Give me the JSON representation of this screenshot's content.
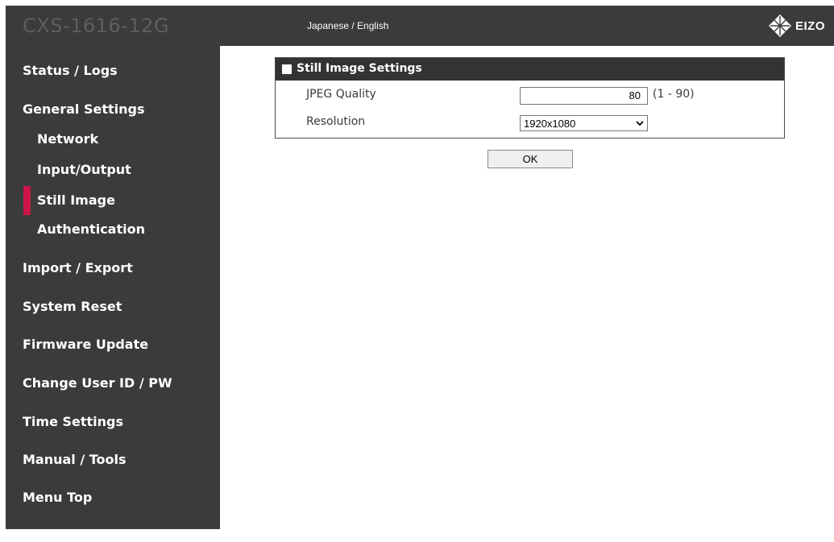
{
  "header": {
    "product_name": "CXS-1616-12G",
    "language_links": "Japanese / English",
    "logo_text": "EIZO"
  },
  "sidebar": {
    "items": [
      {
        "label": "Status / Logs"
      },
      {
        "label": "General Settings"
      },
      {
        "label": "Network"
      },
      {
        "label": "Input/Output"
      },
      {
        "label": "Still Image",
        "active": true
      },
      {
        "label": "Authentication"
      },
      {
        "label": "Import / Export"
      },
      {
        "label": "System Reset"
      },
      {
        "label": "Firmware Update"
      },
      {
        "label": "Change User ID / PW"
      },
      {
        "label": "Time Settings"
      },
      {
        "label": "Manual / Tools"
      },
      {
        "label": "Menu Top"
      }
    ]
  },
  "panel": {
    "title": "Still Image Settings",
    "jpeg_quality_label": "JPEG Quality",
    "jpeg_quality_value": "80",
    "jpeg_quality_range": "(1 - 90)",
    "resolution_label": "Resolution",
    "resolution_value": "1920x1080"
  },
  "actions": {
    "ok_label": "OK"
  },
  "colors": {
    "sidebar_bg": "#3b3b3b",
    "active_accent": "#cc1648",
    "panel_header_bg": "#333333"
  }
}
